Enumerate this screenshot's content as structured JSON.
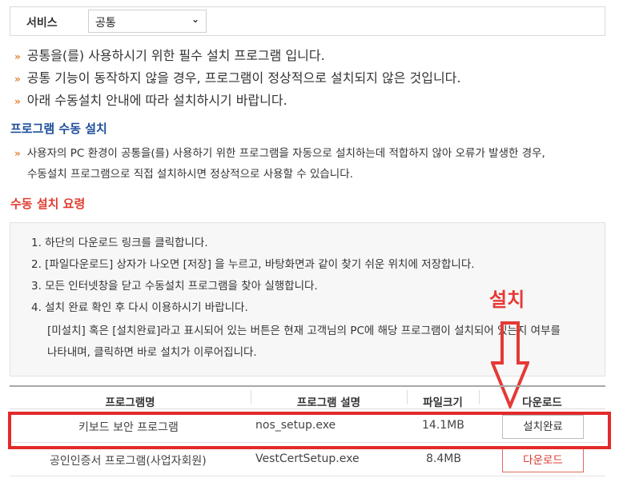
{
  "service": {
    "label": "서비스",
    "selected": "공통",
    "chevron": "chevron-down-icon"
  },
  "notices": [
    "공통을(를) 사용하시기 위한 필수 설치 프로그램 입니다.",
    "공통 기능이 동작하지 않을 경우, 프로그램이 정상적으로 설치되지 않은 것입니다.",
    "아래 수동설치 안내에 따라 설치하시기 바랍니다."
  ],
  "manual_install": {
    "heading": "프로그램 수동 설치",
    "line1": "사용자의 PC 환경이 공통을(를) 사용하기 위한 프로그램을 자동으로 설치하는데 적합하지 않아 오류가 발생한 경우,",
    "line2": "수동설치 프로그램으로 직접 설치하시면 정상적으로 사용할 수 있습니다."
  },
  "guide": {
    "heading": "수동 설치 요령",
    "steps": [
      "1.  하단의 다운로드 링크를 클릭합니다.",
      "2.  [파일다운로드] 상자가 나오면 [저장] 을 누르고, 바탕화면과 같이 찾기 쉬운 위치에 저장합니다.",
      "3.  모든 인터넷창을 닫고 수동설치 프로그램을 찾아 실행합니다.",
      "4.  설치 완료 확인 후 다시 이용하시기 바랍니다."
    ],
    "note1": "[미설치] 혹은 [설치완료]라고 표시되어 있는 버튼은 현재 고객님의 PC에 해당 프로그램이 설치되어 있는지 여부를",
    "note2": "나타내며, 클릭하면 바로 설치가 이루어집니다."
  },
  "callout": "설치",
  "table": {
    "headers": [
      "프로그램명",
      "프로그램 설명",
      "파일크기",
      "다운로드"
    ],
    "rows": [
      {
        "name": "키보드 보안 프로그램",
        "file": "nos_setup.exe",
        "size": "14.1MB",
        "action": "설치완료"
      },
      {
        "name": "공인인증서 프로그램(사업자회원)",
        "file": "VestCertSetup.exe",
        "size": "8.4MB",
        "action": "다운로드"
      }
    ]
  },
  "colors": {
    "accent_orange": "#e0802b",
    "heading_blue": "#1d4f9a",
    "heading_red": "#e03c31",
    "highlight_red": "#e32a2a"
  }
}
